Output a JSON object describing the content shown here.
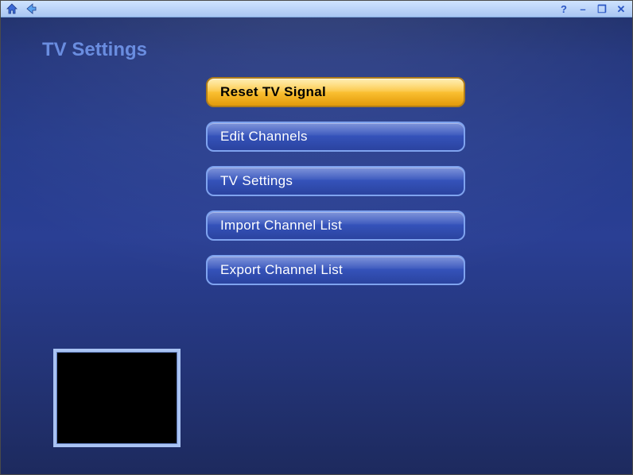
{
  "page_title": "TV Settings",
  "menu": {
    "items": [
      {
        "label": "Reset TV Signal",
        "selected": true
      },
      {
        "label": "Edit Channels",
        "selected": false
      },
      {
        "label": "TV Settings",
        "selected": false
      },
      {
        "label": "Import Channel List",
        "selected": false
      },
      {
        "label": "Export Channel List",
        "selected": false
      }
    ]
  },
  "titlebar": {
    "home": "home-icon",
    "back": "back-icon",
    "help": "?",
    "minimize": "–",
    "restore": "❐",
    "close": "✕"
  }
}
